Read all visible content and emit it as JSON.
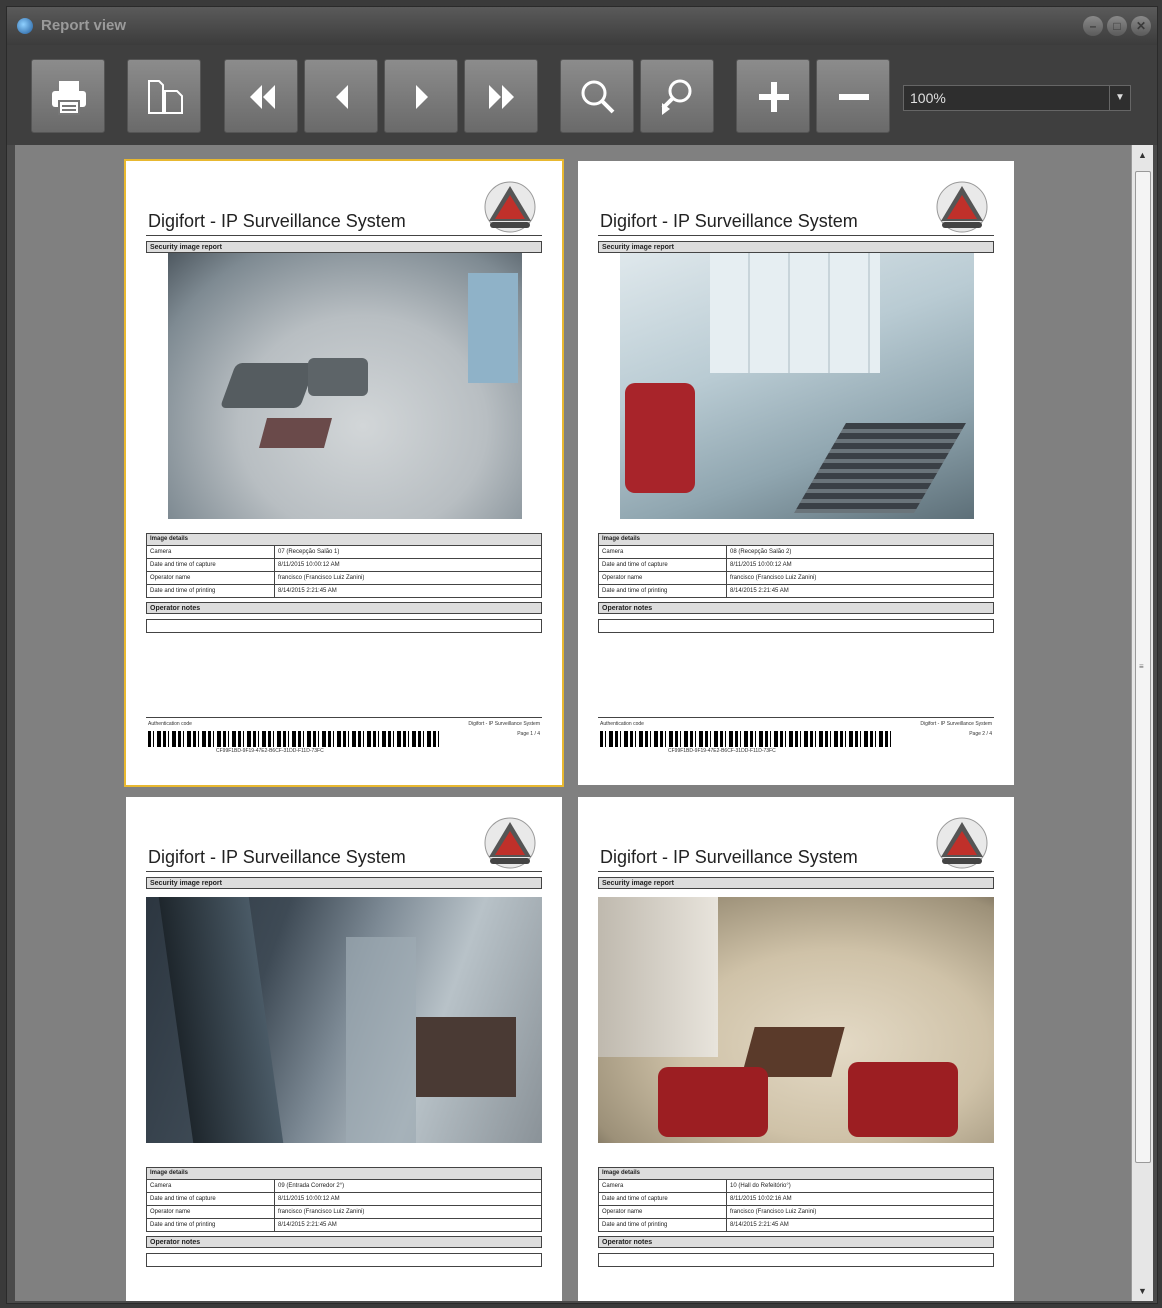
{
  "window": {
    "title": "Report view"
  },
  "toolbar": {
    "buttons": [
      {
        "name": "print-button",
        "icon": "printer-icon"
      },
      {
        "name": "page-setup-button",
        "icon": "page-setup-icon"
      },
      {
        "name": "first-page-button",
        "icon": "first-page-icon"
      },
      {
        "name": "previous-page-button",
        "icon": "previous-page-icon"
      },
      {
        "name": "next-page-button",
        "icon": "next-page-icon"
      },
      {
        "name": "last-page-button",
        "icon": "last-page-icon"
      },
      {
        "name": "find-button",
        "icon": "magnifier-icon"
      },
      {
        "name": "find-next-button",
        "icon": "magnifier-next-icon"
      },
      {
        "name": "zoom-in-button",
        "icon": "plus-icon"
      },
      {
        "name": "zoom-out-button",
        "icon": "minus-icon"
      }
    ],
    "zoom": "100%"
  },
  "report": {
    "title": "Digifort - IP Surveillance System",
    "section_title": "Security image report",
    "details_title": "Image details",
    "labels": {
      "camera": "Camera",
      "capture": "Date and time of capture",
      "operator": "Operator name",
      "printing": "Date and time of printing"
    },
    "notes_title": "Operator notes",
    "footer_left": "Authentication code",
    "footer_right": "Digifort - IP Surveillance System",
    "barcode_text": "CF99F1BD-9F19-47E2-B6CF-31DD-F11D-73FC"
  },
  "pages": [
    {
      "camera": "07 (Recepção Salão 1)",
      "capture": "8/11/2015 10:00:12 AM",
      "operator": "francisco (Francisco Luiz Zanini)",
      "printing": "8/14/2015 2:21:45 AM",
      "page_label": "Page 1 / 4"
    },
    {
      "camera": "08 (Recepção Salão 2)",
      "capture": "8/11/2015 10:00:12 AM",
      "operator": "francisco (Francisco Luiz Zanini)",
      "printing": "8/14/2015 2:21:45 AM",
      "page_label": "Page 2 / 4"
    },
    {
      "camera": "09 (Entrada Corredor 2°)",
      "capture": "8/11/2015 10:00:12 AM",
      "operator": "francisco (Francisco Luiz Zanini)",
      "printing": "8/14/2015 2:21:45 AM"
    },
    {
      "camera": "10 (Hall do Refeitório°)",
      "capture": "8/11/2015 10:02:16 AM",
      "operator": "francisco (Francisco Luiz Zanini)",
      "printing": "8/14/2015 2:21:45 AM"
    }
  ],
  "colors": {
    "selected_page_border": "#e8b830",
    "logo_red": "#c0302a"
  }
}
